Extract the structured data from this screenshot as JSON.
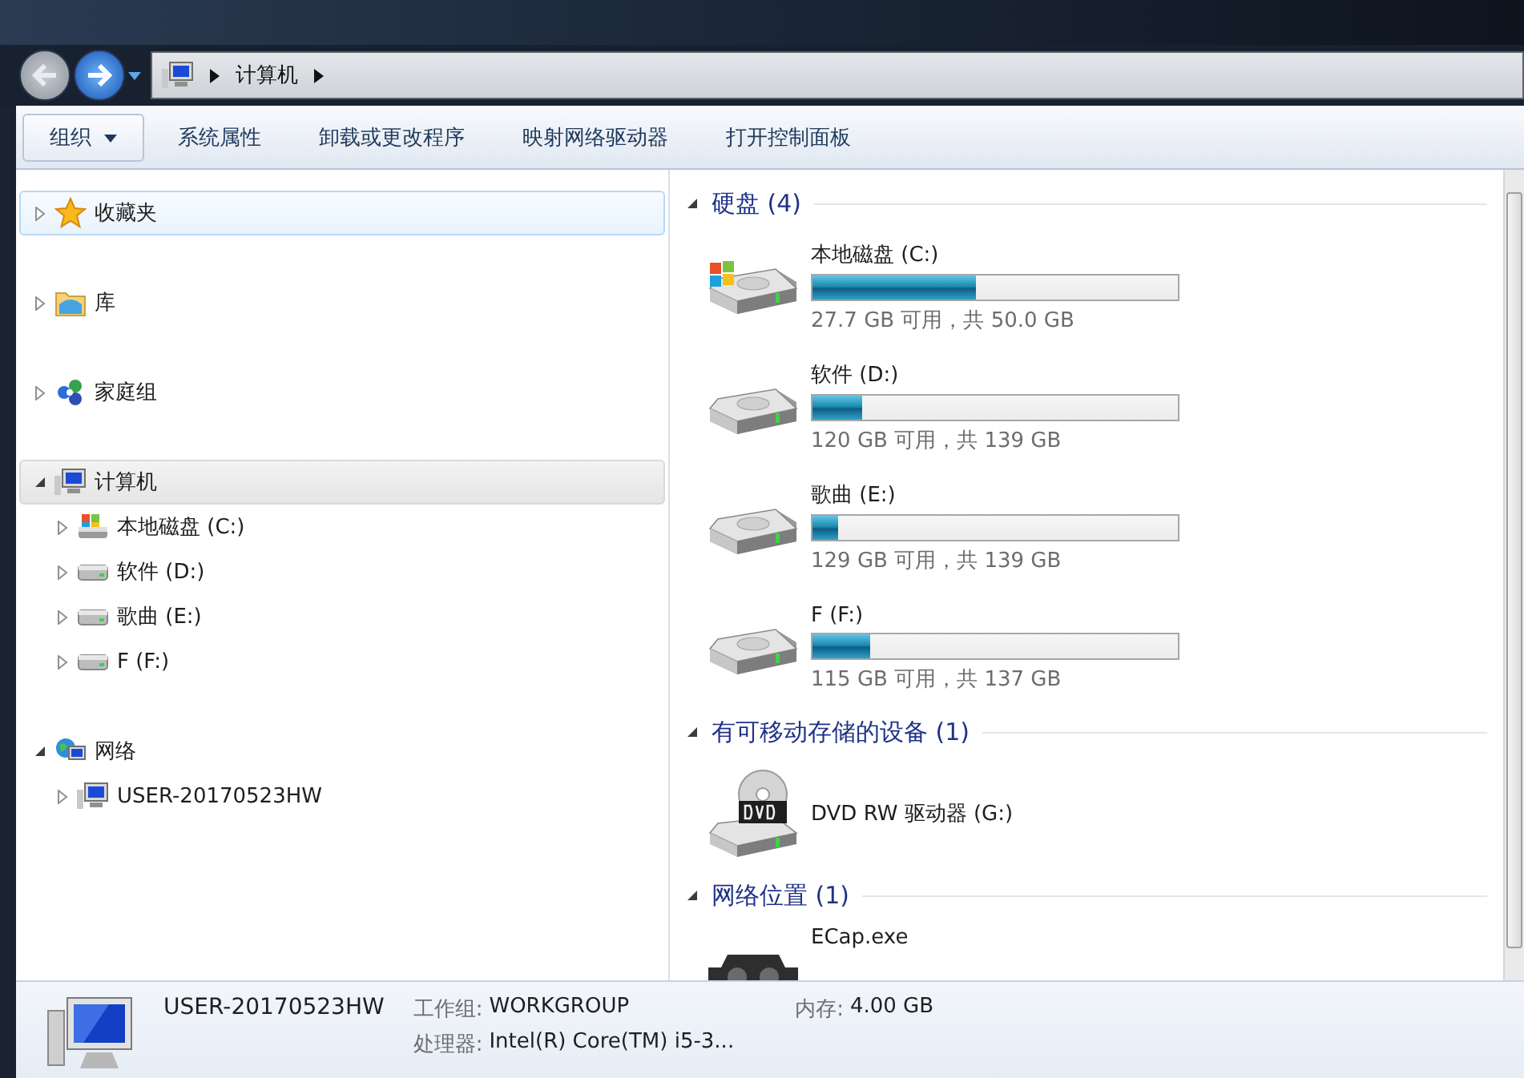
{
  "address_bar": {
    "back_disabled": true,
    "path": [
      "计算机"
    ]
  },
  "toolbar": [
    {
      "label": "组织",
      "kind": "menu"
    },
    {
      "label": "系统属性",
      "kind": "button"
    },
    {
      "label": "卸载或更改程序",
      "kind": "button"
    },
    {
      "label": "映射网络驱动器",
      "kind": "button"
    },
    {
      "label": "打开控制面板",
      "kind": "button"
    }
  ],
  "nav_tree": [
    {
      "label": "收藏夹",
      "kind": "star",
      "expanded": false,
      "selected": false,
      "hovered": true
    },
    {
      "label": "库",
      "kind": "library",
      "expanded": false,
      "selected": false,
      "hovered": false
    },
    {
      "label": "家庭组",
      "kind": "homegroup",
      "expanded": false,
      "selected": false,
      "hovered": false
    },
    {
      "label": "计算机",
      "kind": "computer",
      "expanded": true,
      "selected": true,
      "hovered": false,
      "children": [
        {
          "label": "本地磁盘 (C:)",
          "kind": "system-drive",
          "expanded": false,
          "selected": false,
          "hovered": false
        },
        {
          "label": "软件 (D:)",
          "kind": "drive",
          "expanded": false,
          "selected": false,
          "hovered": false
        },
        {
          "label": "歌曲 (E:)",
          "kind": "drive",
          "expanded": false,
          "selected": false,
          "hovered": false
        },
        {
          "label": "F (F:)",
          "kind": "drive",
          "expanded": false,
          "selected": false,
          "hovered": false
        }
      ]
    },
    {
      "label": "网络",
      "kind": "network",
      "expanded": true,
      "selected": false,
      "hovered": false,
      "children": [
        {
          "label": "USER-20170523HW",
          "kind": "computer",
          "expanded": false,
          "selected": false,
          "hovered": false
        }
      ]
    }
  ],
  "groups": [
    {
      "title": "硬盘 (4)",
      "expanded": true,
      "items": [
        {
          "kind": "system-drive",
          "name": "本地磁盘 (C:)",
          "level": 0.446,
          "space": "27.7 GB 可用，共 50.0 GB"
        },
        {
          "kind": "drive",
          "name": "软件 (D:)",
          "level": 0.137,
          "space": "120 GB 可用，共 139 GB"
        },
        {
          "kind": "drive",
          "name": "歌曲 (E:)",
          "level": 0.072,
          "space": "129 GB 可用，共 139 GB"
        },
        {
          "kind": "drive",
          "name": "F (F:)",
          "level": 0.16,
          "space": "115 GB 可用，共 137 GB"
        }
      ]
    },
    {
      "title": "有可移动存储的设备 (1)",
      "expanded": true,
      "items": [
        {
          "kind": "dvd",
          "name": "DVD RW 驱动器 (G:)"
        }
      ]
    },
    {
      "title": "网络位置 (1)",
      "expanded": true,
      "items": [
        {
          "kind": "network-app",
          "name": "ECap.exe"
        }
      ]
    }
  ],
  "details": {
    "name": "USER-20170523HW",
    "fields": [
      {
        "label": "工作组:",
        "value": "WORKGROUP"
      },
      {
        "label": "内存:",
        "value": "4.00 GB"
      },
      {
        "label": "处理器:",
        "value": "Intel(R) Core(TM) i5-3..."
      }
    ]
  }
}
